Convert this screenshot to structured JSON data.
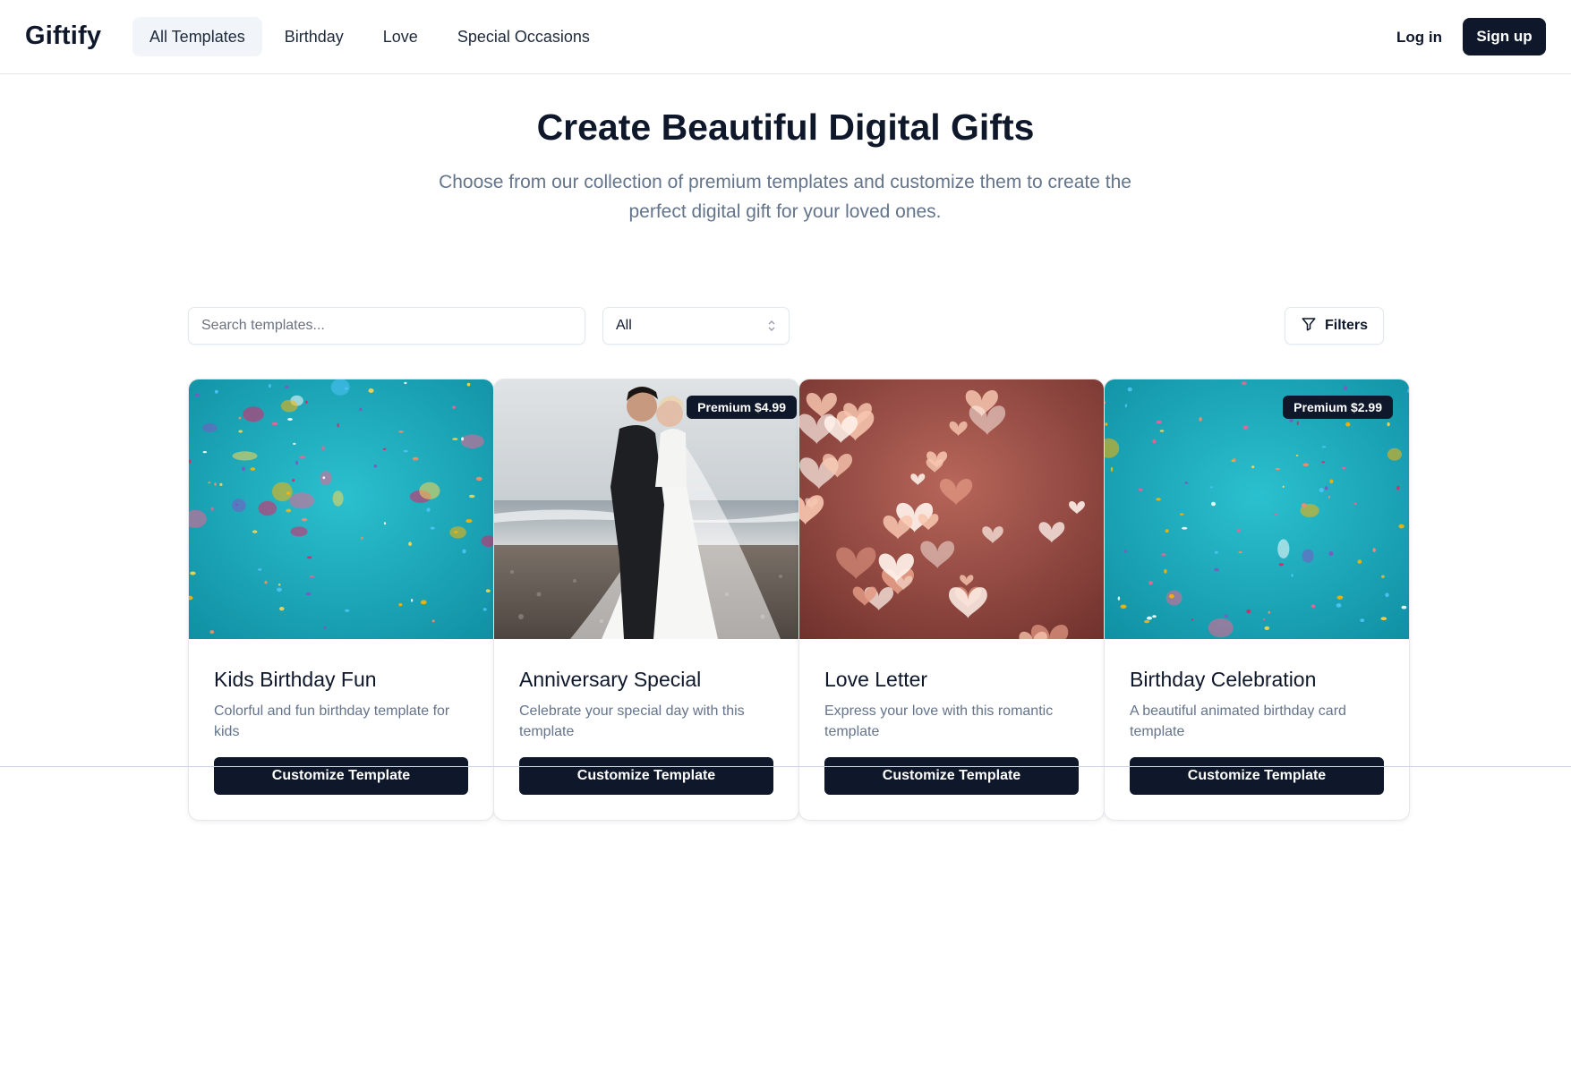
{
  "header": {
    "logo": "Giftify",
    "nav": [
      {
        "label": "All Templates",
        "active": true
      },
      {
        "label": "Birthday",
        "active": false
      },
      {
        "label": "Love",
        "active": false
      },
      {
        "label": "Special Occasions",
        "active": false
      }
    ],
    "login_label": "Log in",
    "signup_label": "Sign up"
  },
  "hero": {
    "title": "Create Beautiful Digital Gifts",
    "subtitle": "Choose from our collection of premium templates and customize them to create the perfect digital gift for your loved ones."
  },
  "toolbar": {
    "search_placeholder": "Search templates...",
    "category_value": "All",
    "filters_label": "Filters"
  },
  "templates": [
    {
      "title": "Kids Birthday Fun",
      "description": "Colorful and fun birthday template for kids",
      "badge": "",
      "image": "confetti",
      "cta": "Customize Template"
    },
    {
      "title": "Anniversary Special",
      "description": "Celebrate your special day with this template",
      "badge": "Premium $4.99",
      "image": "wedding-couple",
      "cta": "Customize Template"
    },
    {
      "title": "Love Letter",
      "description": "Express your love with this romantic template",
      "badge": "",
      "image": "bokeh-hearts",
      "cta": "Customize Template"
    },
    {
      "title": "Birthday Celebration",
      "description": "A beautiful animated birthday card template",
      "badge": "Premium $2.99",
      "image": "confetti",
      "cta": "Customize Template"
    }
  ],
  "colors": {
    "primary": "#0f172a",
    "muted_text": "#64748b",
    "border": "#e5e7eb",
    "confetti_bg": "#1fb3c4",
    "hearts_bg": "#8a3e38"
  }
}
